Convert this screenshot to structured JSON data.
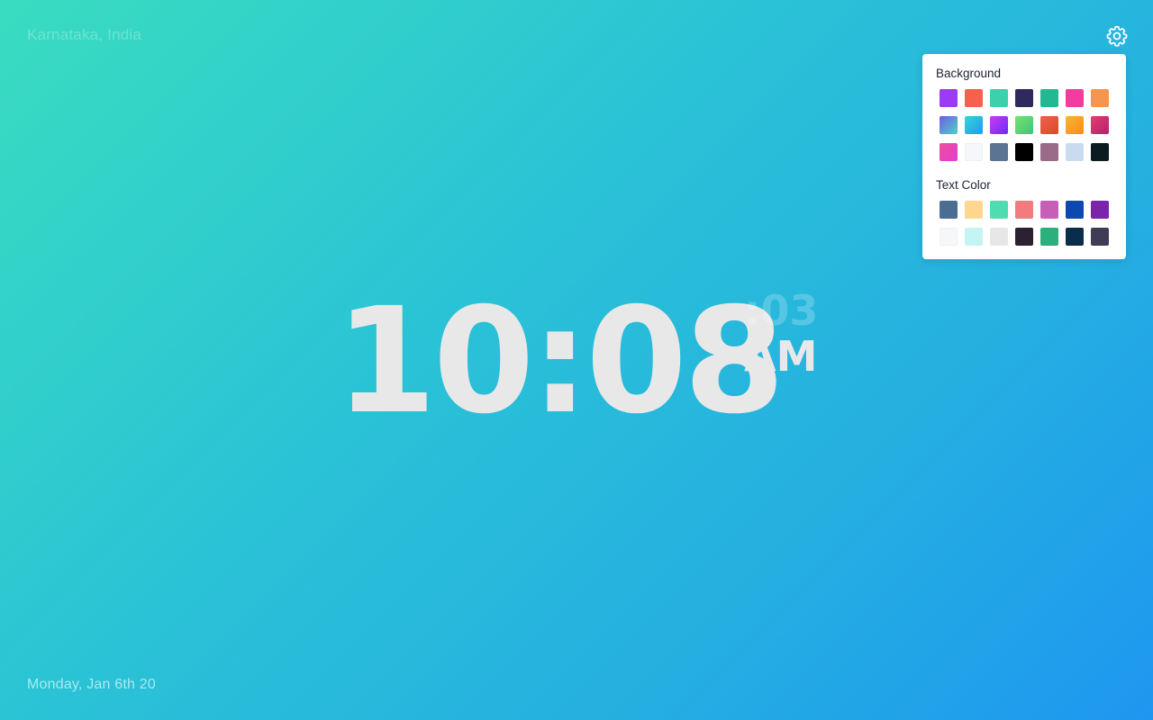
{
  "location": "Karnataka, India",
  "date": "Monday, Jan 6th 20",
  "clock": {
    "time": "10:08",
    "seconds": ":03",
    "ampm": "AM"
  },
  "settings": {
    "icon": "gear-icon",
    "background_label": "Background",
    "text_color_label": "Text Color",
    "background_swatches": [
      "#9b3bf5",
      "#f5604f",
      "#3ecfad",
      "#2f2a5e",
      "#22b894",
      "#f23d9e",
      "#f7944d",
      "linear-gradient(135deg,#6c5ce7,#4fd1c5)",
      "linear-gradient(135deg,#37d5d6,#1e9bf0)",
      "linear-gradient(135deg,#c93df0,#6a2bf5)",
      "linear-gradient(135deg,#7be06a,#3bc67f)",
      "linear-gradient(135deg,#f0614a,#d94a2b)",
      "linear-gradient(135deg,#f7b733,#fc8a17)",
      "linear-gradient(135deg,#e43f6f,#b31f6e)",
      "linear-gradient(135deg,#f04c9a,#e33fd0)",
      "#f6f7fa",
      "#5b7493",
      "#000000",
      "#9b6b8a",
      "#c9dcef",
      "#0b1c21"
    ],
    "text_swatches": [
      "#4b6d91",
      "#ffd68e",
      "#4fdcb1",
      "#f27b7e",
      "#c75fb9",
      "#0d47b0",
      "#7a23ad",
      "#f6f7f9",
      "#c4f5f5",
      "#e7e7e7",
      "#2c2133",
      "#2bb07c",
      "#0b2d4c",
      "#3f3d56"
    ]
  }
}
